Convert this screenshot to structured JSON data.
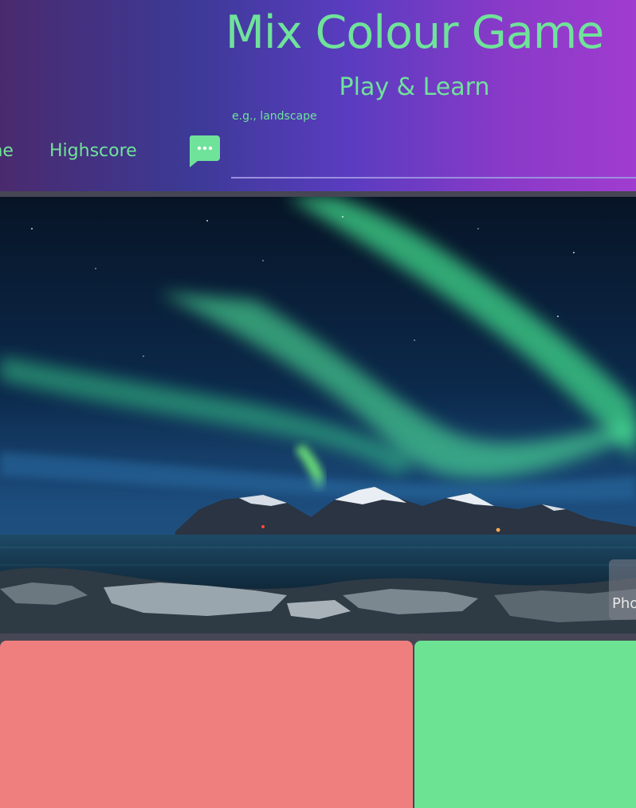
{
  "header": {
    "title": "Mix Colour Game",
    "subtitle": "Play & Learn",
    "nav": {
      "home_label": "me",
      "highscore_label": "Highscore"
    },
    "chat_icon": "chat-bubble-icon",
    "search": {
      "label": "e.g., landscape",
      "value": ""
    }
  },
  "hero": {
    "image": "aurora-over-mountains-lake",
    "photo_credit_label": "Pho"
  },
  "color_options": [
    {
      "color": "#ef7f7e"
    },
    {
      "color": "#6ce392"
    }
  ],
  "colors": {
    "accent_green": "#6fe39a",
    "page_bg": "#464654",
    "divider": "#9b8fe0"
  }
}
